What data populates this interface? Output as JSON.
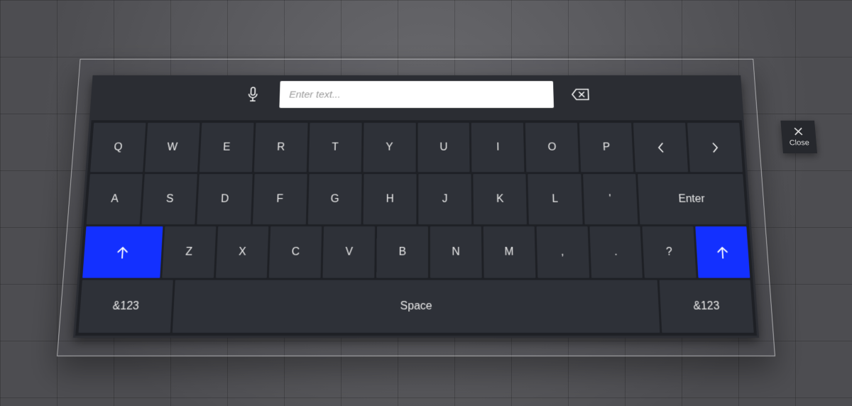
{
  "input": {
    "placeholder": "Enter text..."
  },
  "close": {
    "label": "Close"
  },
  "icons": {
    "mic": "microphone-icon",
    "backspace": "backspace-icon",
    "caret_left": "caret-left-icon",
    "caret_right": "caret-right-icon",
    "shift": "arrow-up-icon",
    "close_x": "close-icon"
  },
  "colors": {
    "shift_active": "#1330ff",
    "panel": "#2b2d33",
    "board": "#1e2025",
    "key": "#2e3138",
    "text": "#eaeaea"
  },
  "rows": {
    "r1": [
      "Q",
      "W",
      "E",
      "R",
      "T",
      "Y",
      "U",
      "I",
      "O",
      "P"
    ],
    "r2": [
      "A",
      "S",
      "D",
      "F",
      "G",
      "H",
      "J",
      "K",
      "L",
      "'"
    ],
    "r2_enter": "Enter",
    "r3": [
      "Z",
      "X",
      "C",
      "V",
      "B",
      "N",
      "M",
      ",",
      ".",
      "?"
    ],
    "r4": {
      "symbols_left": "&123",
      "space": "Space",
      "symbols_right": "&123"
    }
  }
}
